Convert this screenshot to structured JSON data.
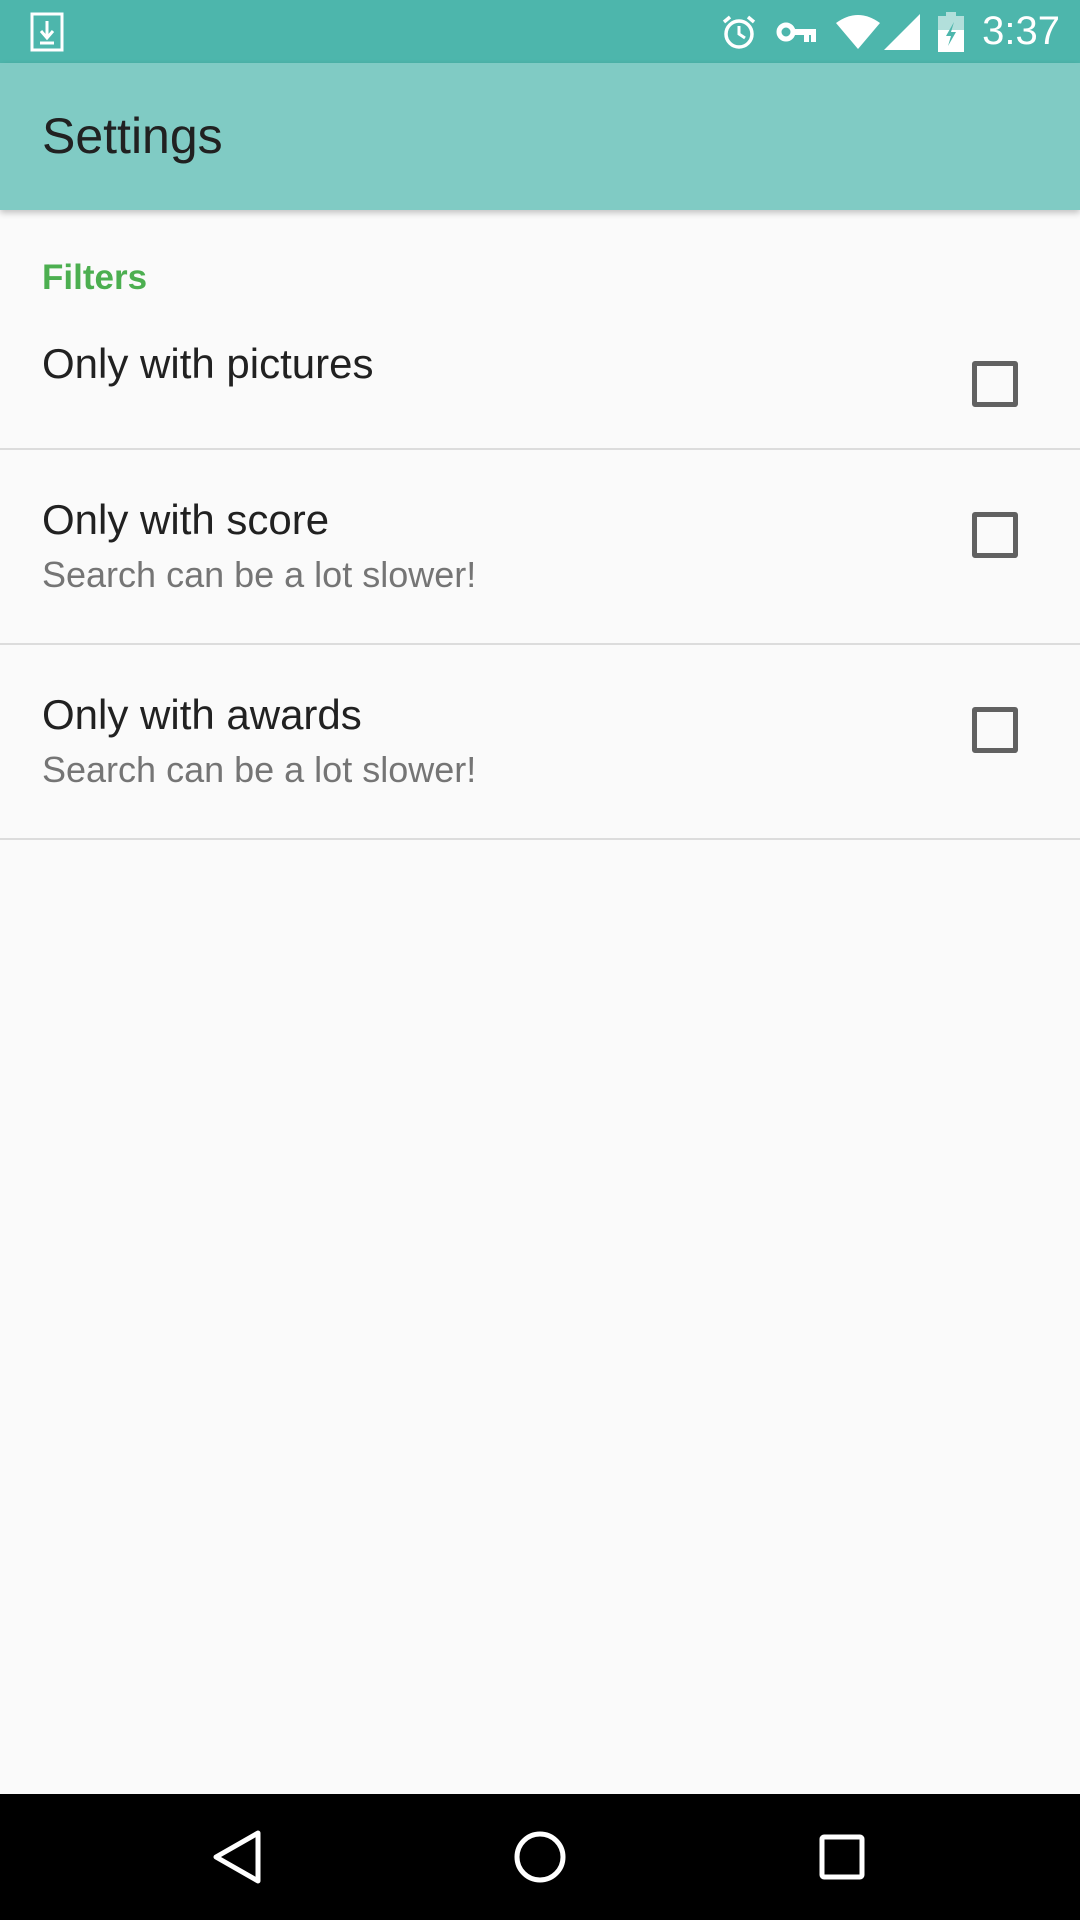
{
  "status_bar": {
    "time": "3:37",
    "icons": [
      "download-icon",
      "alarm-icon",
      "vpn-key-icon",
      "wifi-icon",
      "signal-icon",
      "battery-icon"
    ]
  },
  "app_bar": {
    "title": "Settings"
  },
  "settings": {
    "category": "Filters",
    "items": [
      {
        "title": "Only with pictures",
        "summary": "",
        "checked": false
      },
      {
        "title": "Only with score",
        "summary": "Search can be a lot slower!",
        "checked": false
      },
      {
        "title": "Only with awards",
        "summary": "Search can be a lot slower!",
        "checked": false
      }
    ]
  },
  "nav_bar": {
    "icons": [
      "back-icon",
      "home-icon",
      "recents-icon"
    ]
  },
  "colors": {
    "status_bar": "#4db6ac",
    "app_bar": "#80cbc4",
    "category_accent": "#4caf50",
    "background": "#fafafa"
  }
}
